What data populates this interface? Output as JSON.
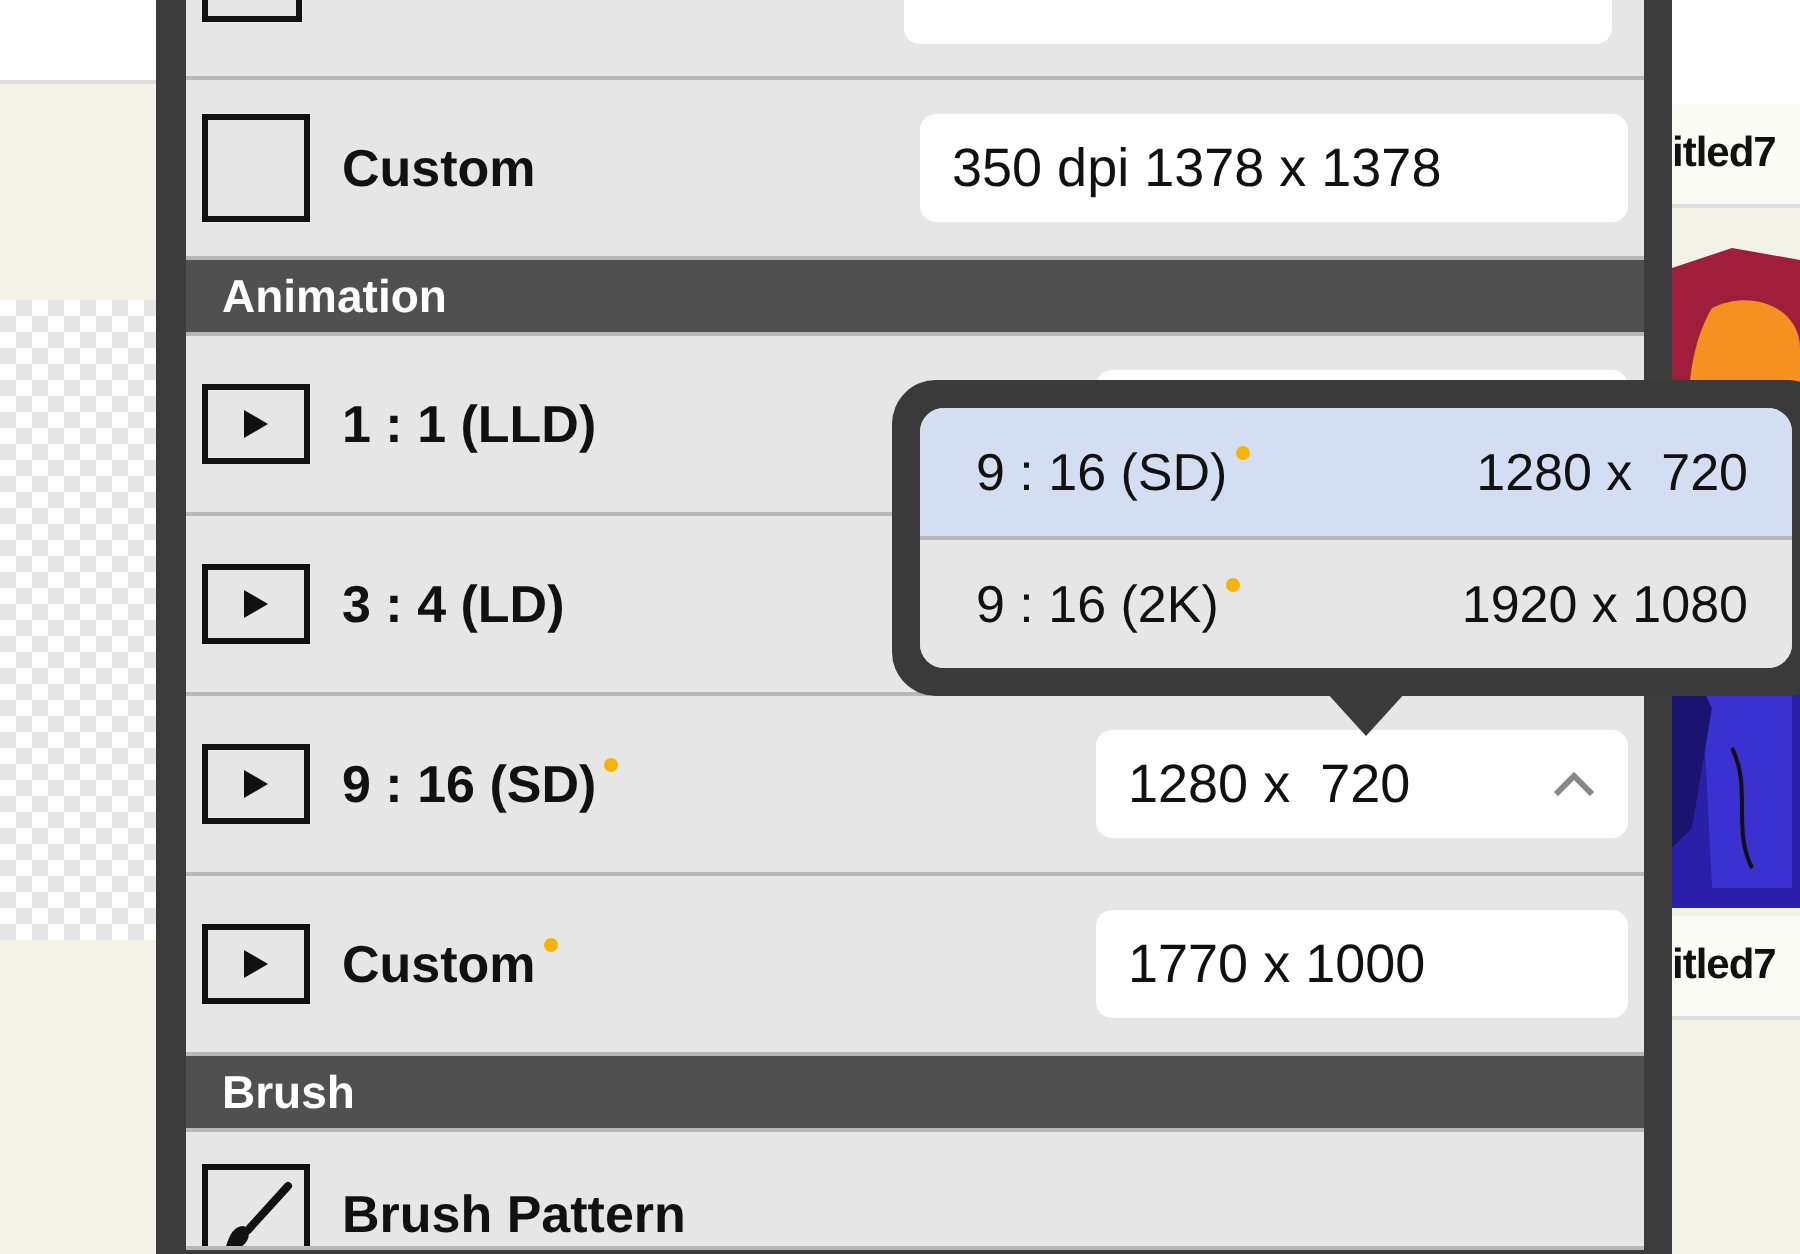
{
  "canvas_rows": [
    {
      "kind": "square",
      "label": "Custom",
      "value": "350 dpi 1378 x 1378"
    }
  ],
  "sections": [
    {
      "title": "Animation",
      "rows": [
        {
          "kind": "play",
          "label": "1 : 1 (LLD)",
          "dot": false,
          "covered_field": true
        },
        {
          "kind": "play",
          "label": "3 : 4 (LD)",
          "dot": false
        },
        {
          "kind": "play",
          "label": "9 : 16 (SD)",
          "dot": true,
          "value": "1280 x  720",
          "expanded": true
        },
        {
          "kind": "play",
          "label": "Custom",
          "dot": true,
          "value": "1770 x 1000"
        }
      ]
    },
    {
      "title": "Brush",
      "rows": [
        {
          "kind": "brush",
          "label": "Brush Pattern",
          "dot": false
        }
      ]
    }
  ],
  "popup": {
    "options": [
      {
        "label": "9 : 16 (SD)",
        "dot": true,
        "value": "1280 x  720",
        "selected": true
      },
      {
        "label": "9 : 16 (2K)",
        "dot": true,
        "value": "1920 x 1080",
        "selected": false
      }
    ]
  },
  "file_labels": [
    "itled7",
    "itled7"
  ]
}
